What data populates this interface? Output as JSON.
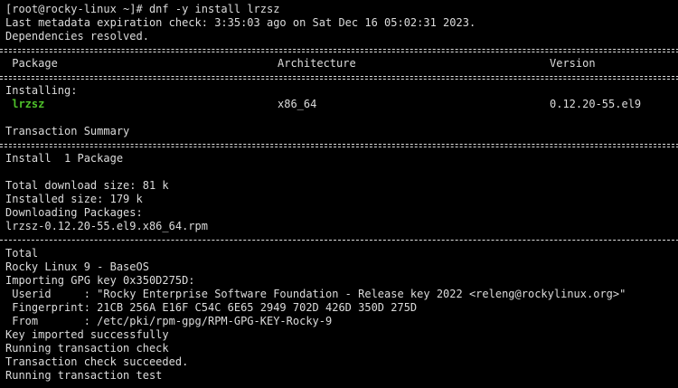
{
  "terminal": {
    "prompt": "[root@rocky-linux ~]# ",
    "command": "dnf -y install lrzsz",
    "metadata_check": "Last metadata expiration check: 3:35:03 ago on Sat Dec 16 05:02:31 2023.",
    "deps_resolved": "Dependencies resolved.",
    "table": {
      "headers": [
        " Package",
        "Architecture",
        "Version"
      ],
      "section_label": "Installing:",
      "rows": [
        {
          "package": " lrzsz",
          "arch": "x86_64",
          "version": "0.12.20-55.el9"
        }
      ]
    },
    "transaction_summary": "Transaction Summary",
    "install_line": "Install  1 Package",
    "total_download": "Total download size: 81 k",
    "installed_size": "Installed size: 179 k",
    "downloading": "Downloading Packages:",
    "rpm_file": "lrzsz-0.12.20-55.el9.x86_64.rpm",
    "total": "Total",
    "repo": "Rocky Linux 9 - BaseOS",
    "importing_gpg": "Importing GPG key 0x350D275D:",
    "userid": " Userid     : \"Rocky Enterprise Software Foundation - Release key 2022 <releng@rockylinux.org>\"",
    "fingerprint": " Fingerprint: 21CB 256A E16F C54C 6E65 2949 702D 426D 350D 275D",
    "from": " From       : /etc/pki/rpm-gpg/RPM-GPG-KEY-Rocky-9",
    "key_imported": "Key imported successfully",
    "running_check": "Running transaction check",
    "check_succeeded": "Transaction check succeeded.",
    "running_test": "Running transaction test"
  },
  "colors": {
    "background": "#000000",
    "foreground": "#dcdcdc",
    "package_highlight": "#4ec02a"
  }
}
